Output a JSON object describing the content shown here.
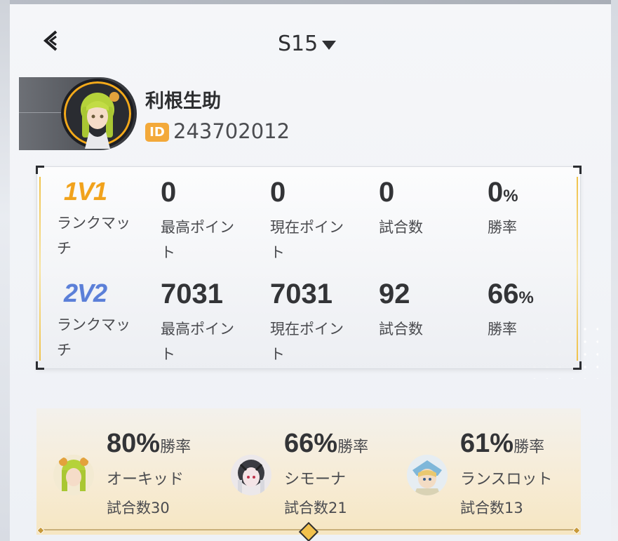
{
  "header": {
    "season_label": "S15"
  },
  "player": {
    "name": "利根生助",
    "id_badge": "ID",
    "id_value": "243702012"
  },
  "modes": [
    {
      "badge": "1V1",
      "label": "ランクマッチ",
      "stats": [
        {
          "value": "0",
          "suffix": "",
          "label": "最高ポイント"
        },
        {
          "value": "0",
          "suffix": "",
          "label": "現在ポイント"
        },
        {
          "value": "0",
          "suffix": "",
          "label": "試合数"
        },
        {
          "value": "0",
          "suffix": "%",
          "label": "勝率"
        }
      ]
    },
    {
      "badge": "2V2",
      "label": "ランクマッチ",
      "stats": [
        {
          "value": "7031",
          "suffix": "",
          "label": "最高ポイント"
        },
        {
          "value": "7031",
          "suffix": "",
          "label": "現在ポイント"
        },
        {
          "value": "92",
          "suffix": "",
          "label": "試合数"
        },
        {
          "value": "66",
          "suffix": "%",
          "label": "勝率"
        }
      ]
    }
  ],
  "heroes": [
    {
      "rate": "80%",
      "rate_suffix": "勝率",
      "name": "オーキッド",
      "games": "試合数30",
      "icon": "orchid-avatar-icon"
    },
    {
      "rate": "66%",
      "rate_suffix": "勝率",
      "name": "シモーナ",
      "games": "試合数21",
      "icon": "simona-avatar-icon"
    },
    {
      "rate": "61%",
      "rate_suffix": "勝率",
      "name": "ランスロット",
      "games": "試合数13",
      "icon": "lancelot-avatar-icon"
    }
  ],
  "colors": {
    "accent_gold": "#f1a21c",
    "badge_1v1": "#f1a21c",
    "badge_2v2": "#5b7fd8",
    "id_badge": "#f3a93a"
  }
}
